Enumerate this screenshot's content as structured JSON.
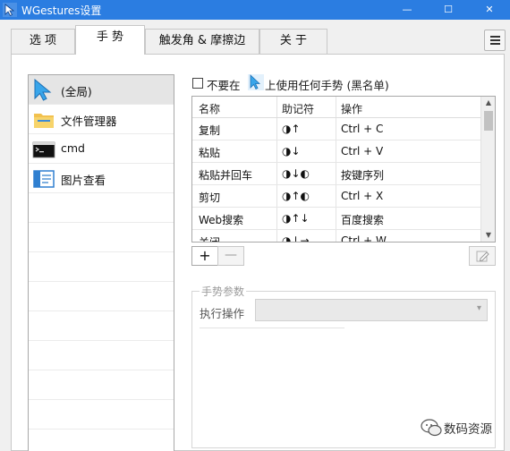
{
  "window": {
    "title": "WGestures设置",
    "controls": {
      "minimize": "—",
      "maximize": "☐",
      "close": "✕"
    },
    "accent_color": "#2b7de1"
  },
  "tabs": [
    {
      "label": "选 项",
      "active": false
    },
    {
      "label": "手 势",
      "active": true
    },
    {
      "label": "触发角 & 摩擦边",
      "active": false
    },
    {
      "label": "关 于",
      "active": false
    }
  ],
  "apps": [
    {
      "label": "(全局)",
      "icon": "cursor-icon",
      "selected": true
    },
    {
      "label": "文件管理器",
      "icon": "folder-icon",
      "selected": false
    },
    {
      "label": "cmd",
      "icon": "terminal-icon",
      "selected": false
    },
    {
      "label": "图片查看",
      "icon": "image-viewer-icon",
      "selected": false
    }
  ],
  "blacklist": {
    "checked": false,
    "text_before": "不要在",
    "text_after": "上使用任何手势 (黑名单)"
  },
  "gesture_table": {
    "columns": [
      "名称",
      "助记符",
      "操作"
    ],
    "rows": [
      {
        "name": "复制",
        "mnemonic": "◑↑",
        "action": "Ctrl + C"
      },
      {
        "name": "粘贴",
        "mnemonic": "◑↓",
        "action": "Ctrl + V"
      },
      {
        "name": "粘贴并回车",
        "mnemonic": "◑↓◐",
        "action": "按键序列"
      },
      {
        "name": "剪切",
        "mnemonic": "◑↑◐",
        "action": "Ctrl + X"
      },
      {
        "name": "Web搜索",
        "mnemonic": "◑↑↓",
        "action": "百度搜索"
      },
      {
        "name": "关闭",
        "mnemonic": "◑↓→",
        "action": "Ctrl + W"
      }
    ]
  },
  "buttons": {
    "add": "+",
    "remove": "—"
  },
  "params": {
    "legend": "手势参数",
    "exec_label": "执行操作",
    "exec_value": ""
  },
  "watermark": {
    "text": "数码资源"
  }
}
